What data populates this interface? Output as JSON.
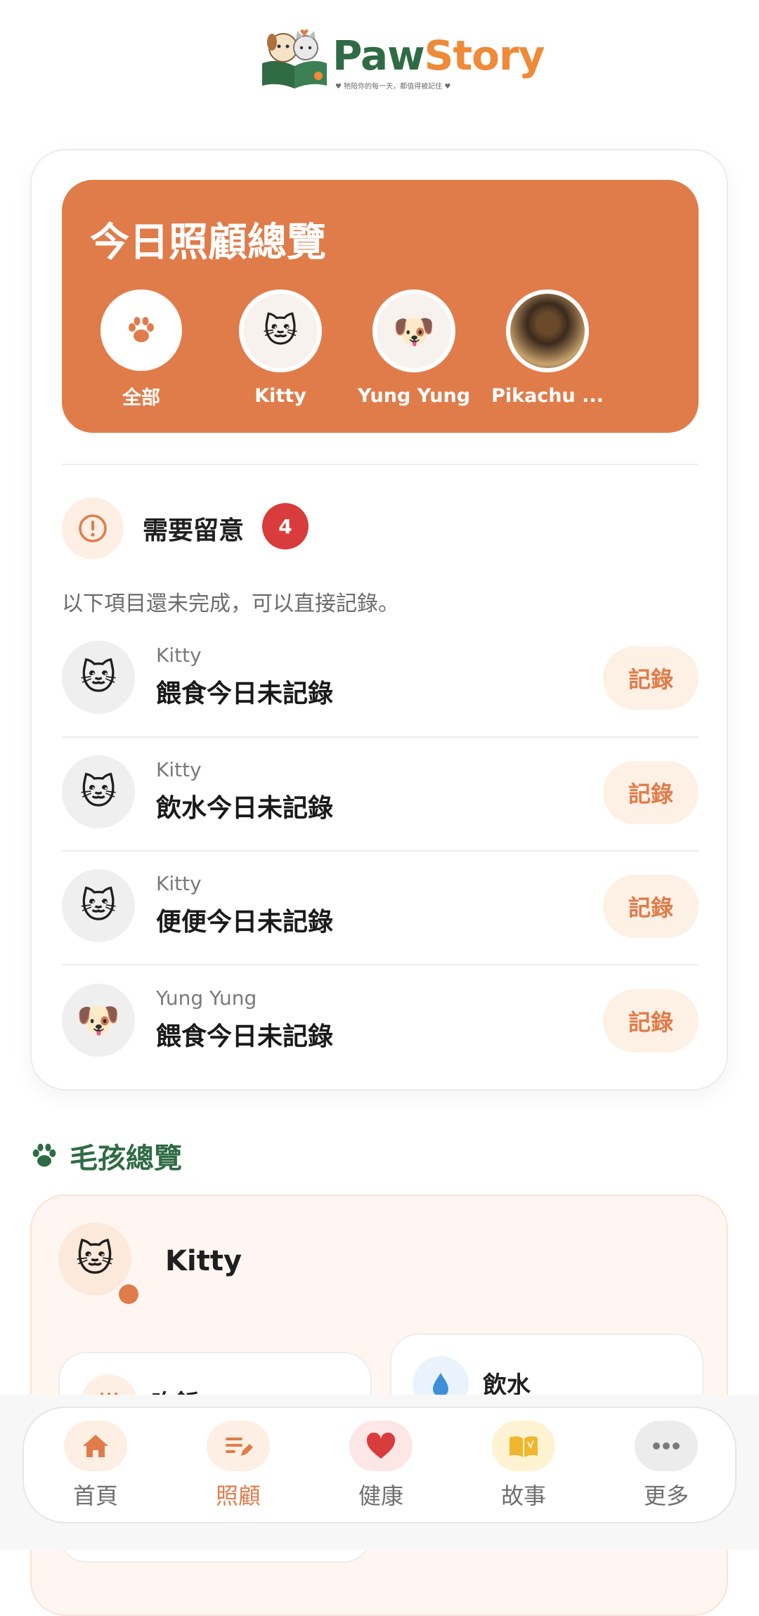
{
  "app": {
    "logo_word_a": "Paw",
    "logo_word_b": "Story",
    "tagline": "♥ 牠陪你的每一天，都值得被記住 ♥"
  },
  "overview": {
    "title": "今日照顧總覽",
    "pets": [
      {
        "label": "全部",
        "icon": "paw-icon"
      },
      {
        "label": "Kitty",
        "icon": "cat-face-icon"
      },
      {
        "label": "Yung Yung",
        "icon": "dog-face-icon"
      },
      {
        "label": "Pikachu ...",
        "icon": "dog-photo"
      }
    ]
  },
  "attention": {
    "title": "需要留意",
    "count": "4",
    "subtitle": "以下項目還未完成，可以直接記錄。",
    "items": [
      {
        "pet": "Kitty",
        "task": "餵食今日未記錄",
        "button": "記錄",
        "icon": "cat-face-icon"
      },
      {
        "pet": "Kitty",
        "task": "飲水今日未記錄",
        "button": "記錄",
        "icon": "cat-face-icon"
      },
      {
        "pet": "Kitty",
        "task": "便便今日未記錄",
        "button": "記錄",
        "icon": "cat-face-icon"
      },
      {
        "pet": "Yung Yung",
        "task": "餵食今日未記錄",
        "button": "記錄",
        "icon": "dog-face-icon"
      }
    ]
  },
  "pets_overview": {
    "title": "毛孩總覽",
    "pet_name": "Kitty",
    "card_right_label": "飲水",
    "card_left_label": "吃飯"
  },
  "nav": {
    "items": [
      {
        "label": "首頁",
        "icon": "home-icon",
        "active": false
      },
      {
        "label": "照顧",
        "icon": "edit-list-icon",
        "active": true
      },
      {
        "label": "健康",
        "icon": "heart-icon",
        "active": false
      },
      {
        "label": "故事",
        "icon": "book-icon",
        "active": false
      },
      {
        "label": "更多",
        "icon": "more-dots-icon",
        "active": false
      }
    ]
  },
  "colors": {
    "accent": "#e07c4a",
    "brand_green": "#2f6b44",
    "badge_red": "#d93c3c"
  }
}
